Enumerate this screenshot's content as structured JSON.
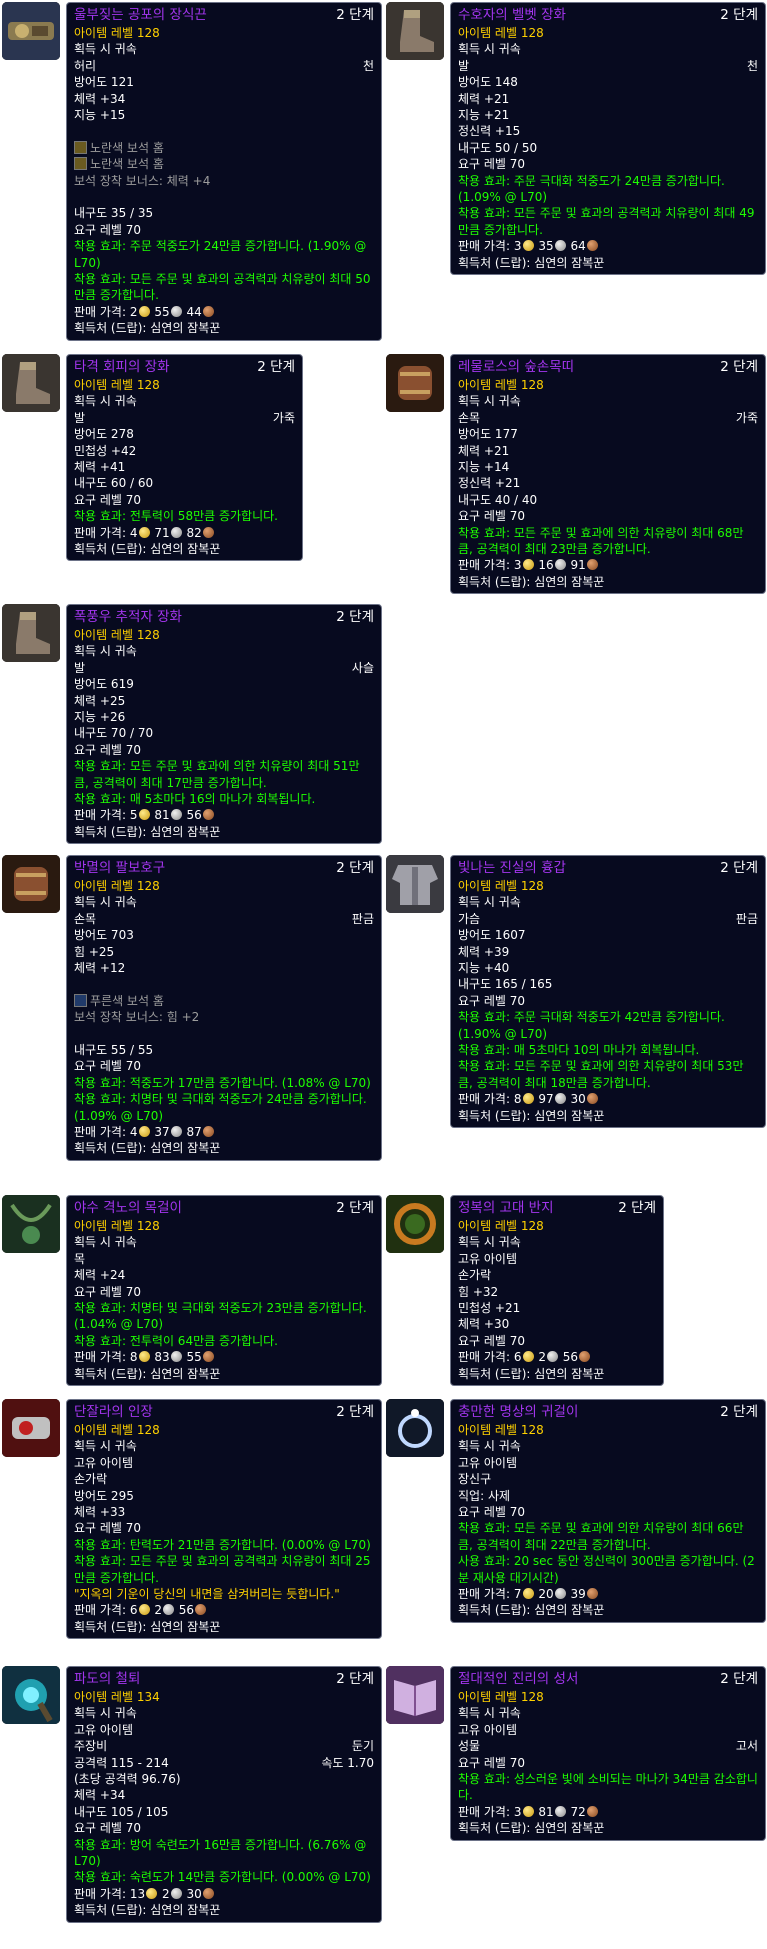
{
  "ui": {
    "stage_suffix": "단계"
  },
  "items": [
    {
      "id": "item1",
      "icon": "belt-icon",
      "name": "울부짖는 공포의 장식끈",
      "stage": "2",
      "rows": [
        {
          "t": "lvl",
          "text": "아이템 레벨 128"
        },
        {
          "t": "txt",
          "text": "획득 시 귀속"
        },
        {
          "t": "slot",
          "text": "허리",
          "right": "천"
        },
        {
          "t": "txt",
          "text": "방어도 121"
        },
        {
          "t": "txt",
          "text": "체력 +34"
        },
        {
          "t": "txt",
          "text": "지능 +15"
        },
        {
          "t": "blank"
        },
        {
          "t": "gem",
          "gem": "y",
          "text": "노란색 보석 홈"
        },
        {
          "t": "gem",
          "gem": "y",
          "text": "노란색 보석 홈"
        },
        {
          "t": "gray",
          "text": "보석 장착 보너스: 체력 +4"
        },
        {
          "t": "blank"
        },
        {
          "t": "txt",
          "text": "내구도 35 / 35"
        },
        {
          "t": "txt",
          "text": "요구 레벨 70"
        },
        {
          "t": "green",
          "text": "착용 효과: 주문 적중도가 24만큼 증가합니다. (1.90% @ L70)"
        },
        {
          "t": "green",
          "text": "착용 효과: 모든 주문 및 효과의 공격력과 치유량이 최대 50만큼 증가합니다."
        },
        {
          "t": "price",
          "label": "판매 가격:",
          "gold": "2",
          "silver": "55",
          "copper": "44"
        },
        {
          "t": "txt",
          "text": "획득처 (드랍): 심연의 잠복꾼"
        }
      ]
    },
    {
      "id": "item2",
      "icon": "boot-icon",
      "name": "수호자의 벨벳 장화",
      "stage": "2",
      "rows": [
        {
          "t": "lvl",
          "text": "아이템 레벨 128"
        },
        {
          "t": "txt",
          "text": "획득 시 귀속"
        },
        {
          "t": "slot",
          "text": "발",
          "right": "천"
        },
        {
          "t": "txt",
          "text": "방어도 148"
        },
        {
          "t": "txt",
          "text": "체력 +21"
        },
        {
          "t": "txt",
          "text": "지능 +21"
        },
        {
          "t": "txt",
          "text": "정신력 +15"
        },
        {
          "t": "txt",
          "text": "내구도 50 / 50"
        },
        {
          "t": "txt",
          "text": "요구 레벨 70"
        },
        {
          "t": "green",
          "text": "착용 효과: 주문 극대화 적중도가 24만큼 증가합니다. (1.09% @ L70)"
        },
        {
          "t": "green",
          "text": "착용 효과: 모든 주문 및 효과의 공격력과 치유량이 최대 49만큼 증가합니다."
        },
        {
          "t": "price",
          "label": "판매 가격:",
          "gold": "3",
          "silver": "35",
          "copper": "64"
        },
        {
          "t": "txt",
          "text": "획득처 (드랍): 심연의 잠복꾼"
        }
      ]
    },
    {
      "id": "item3",
      "icon": "boot-icon",
      "name": "타격 회피의 장화",
      "stage": "2",
      "rows": [
        {
          "t": "lvl",
          "text": "아이템 레벨 128"
        },
        {
          "t": "txt",
          "text": "획득 시 귀속"
        },
        {
          "t": "slot",
          "text": "발",
          "right": "가죽"
        },
        {
          "t": "txt",
          "text": "방어도 278"
        },
        {
          "t": "txt",
          "text": "민첩성 +42"
        },
        {
          "t": "txt",
          "text": "체력 +41"
        },
        {
          "t": "txt",
          "text": "내구도 60 / 60"
        },
        {
          "t": "txt",
          "text": "요구 레벨 70"
        },
        {
          "t": "green",
          "text": "착용 효과: 전투력이 58만큼 증가합니다."
        },
        {
          "t": "price",
          "label": "판매 가격:",
          "gold": "4",
          "silver": "71",
          "copper": "82"
        },
        {
          "t": "txt",
          "text": "획득처 (드랍): 심연의 잠복꾼"
        }
      ]
    },
    {
      "id": "item4",
      "icon": "bracer-icon",
      "name": "레물로스의 숲손목띠",
      "stage": "2",
      "rows": [
        {
          "t": "lvl",
          "text": "아이템 레벨 128"
        },
        {
          "t": "txt",
          "text": "획득 시 귀속"
        },
        {
          "t": "slot",
          "text": "손목",
          "right": "가죽"
        },
        {
          "t": "txt",
          "text": "방어도 177"
        },
        {
          "t": "txt",
          "text": "체력 +21"
        },
        {
          "t": "txt",
          "text": "지능 +14"
        },
        {
          "t": "txt",
          "text": "정신력 +21"
        },
        {
          "t": "txt",
          "text": "내구도 40 / 40"
        },
        {
          "t": "txt",
          "text": "요구 레벨 70"
        },
        {
          "t": "green",
          "text": "착용 효과: 모든 주문 및 효과에 의한 치유량이 최대 68만큼, 공격력이 최대 23만큼 증가합니다."
        },
        {
          "t": "price",
          "label": "판매 가격:",
          "gold": "3",
          "silver": "16",
          "copper": "91"
        },
        {
          "t": "txt",
          "text": "획득처 (드랍): 심연의 잠복꾼"
        }
      ]
    },
    {
      "id": "item5",
      "icon": "boot-icon",
      "name": "폭풍우 추적자 장화",
      "stage": "2",
      "rows": [
        {
          "t": "lvl",
          "text": "아이템 레벨 128"
        },
        {
          "t": "txt",
          "text": "획득 시 귀속"
        },
        {
          "t": "slot",
          "text": "발",
          "right": "사슬"
        },
        {
          "t": "txt",
          "text": "방어도 619"
        },
        {
          "t": "txt",
          "text": "체력 +25"
        },
        {
          "t": "txt",
          "text": "지능 +26"
        },
        {
          "t": "txt",
          "text": "내구도 70 / 70"
        },
        {
          "t": "txt",
          "text": "요구 레벨 70"
        },
        {
          "t": "green",
          "text": "착용 효과: 모든 주문 및 효과에 의한 치유량이 최대 51만큼, 공격력이 최대 17만큼 증가합니다."
        },
        {
          "t": "green",
          "text": "착용 효과: 매 5초마다 16의 마나가 회복됩니다."
        },
        {
          "t": "price",
          "label": "판매 가격:",
          "gold": "5",
          "silver": "81",
          "copper": "56"
        },
        {
          "t": "txt",
          "text": "획득처 (드랍): 심연의 잠복꾼"
        }
      ]
    },
    {
      "id": "item6",
      "icon": "bracer-icon",
      "name": "박멸의 팔보호구",
      "stage": "2",
      "rows": [
        {
          "t": "lvl",
          "text": "아이템 레벨 128"
        },
        {
          "t": "txt",
          "text": "획득 시 귀속"
        },
        {
          "t": "slot",
          "text": "손목",
          "right": "판금"
        },
        {
          "t": "txt",
          "text": "방어도 703"
        },
        {
          "t": "txt",
          "text": "힘 +25"
        },
        {
          "t": "txt",
          "text": "체력 +12"
        },
        {
          "t": "blank"
        },
        {
          "t": "gem",
          "gem": "b",
          "text": "푸른색 보석 홈"
        },
        {
          "t": "gray",
          "text": "보석 장착 보너스: 힘 +2"
        },
        {
          "t": "blank"
        },
        {
          "t": "txt",
          "text": "내구도 55 / 55"
        },
        {
          "t": "txt",
          "text": "요구 레벨 70"
        },
        {
          "t": "green",
          "text": "착용 효과: 적중도가 17만큼 증가합니다. (1.08% @ L70)"
        },
        {
          "t": "green",
          "text": "착용 효과: 치명타 및 극대화 적중도가 24만큼 증가합니다. (1.09% @ L70)"
        },
        {
          "t": "price",
          "label": "판매 가격:",
          "gold": "4",
          "silver": "37",
          "copper": "87"
        },
        {
          "t": "txt",
          "text": "획득처 (드랍): 심연의 잠복꾼"
        }
      ]
    },
    {
      "id": "item7",
      "icon": "chest-icon",
      "name": "빛나는 진실의 흉갑",
      "stage": "2",
      "rows": [
        {
          "t": "lvl",
          "text": "아이템 레벨 128"
        },
        {
          "t": "txt",
          "text": "획득 시 귀속"
        },
        {
          "t": "slot",
          "text": "가슴",
          "right": "판금"
        },
        {
          "t": "txt",
          "text": "방어도 1607"
        },
        {
          "t": "txt",
          "text": "체력 +39"
        },
        {
          "t": "txt",
          "text": "지능 +40"
        },
        {
          "t": "txt",
          "text": "내구도 165 / 165"
        },
        {
          "t": "txt",
          "text": "요구 레벨 70"
        },
        {
          "t": "green",
          "text": "착용 효과: 주문 극대화 적중도가 42만큼 증가합니다. (1.90% @ L70)"
        },
        {
          "t": "green",
          "text": "착용 효과: 매 5초마다 10의 마나가 회복됩니다."
        },
        {
          "t": "green",
          "text": "착용 효과: 모든 주문 및 효과에 의한 치유량이 최대 53만큼, 공격력이 최대 18만큼 증가합니다."
        },
        {
          "t": "price",
          "label": "판매 가격:",
          "gold": "8",
          "silver": "97",
          "copper": "30"
        },
        {
          "t": "txt",
          "text": "획득처 (드랍): 심연의 잠복꾼"
        }
      ]
    },
    {
      "id": "item8",
      "icon": "necklace-icon",
      "name": "야수 격노의 목걸이",
      "stage": "2",
      "rows": [
        {
          "t": "lvl",
          "text": "아이템 레벨 128"
        },
        {
          "t": "txt",
          "text": "획득 시 귀속"
        },
        {
          "t": "txt",
          "text": "목"
        },
        {
          "t": "txt",
          "text": "체력 +24"
        },
        {
          "t": "txt",
          "text": "요구 레벨 70"
        },
        {
          "t": "green",
          "text": "착용 효과: 치명타 및 극대화 적중도가 23만큼 증가합니다. (1.04% @ L70)"
        },
        {
          "t": "green",
          "text": "착용 효과: 전투력이 64만큼 증가합니다."
        },
        {
          "t": "price",
          "label": "판매 가격:",
          "gold": "8",
          "silver": "83",
          "copper": "55"
        },
        {
          "t": "txt",
          "text": "획득처 (드랍): 심연의 잠복꾼"
        }
      ]
    },
    {
      "id": "item9",
      "icon": "ring-icon",
      "name": "정복의 고대 반지",
      "stage": "2",
      "rows": [
        {
          "t": "lvl",
          "text": "아이템 레벨 128"
        },
        {
          "t": "txt",
          "text": "획득 시 귀속"
        },
        {
          "t": "txt",
          "text": "고유 아이템"
        },
        {
          "t": "txt",
          "text": "손가락"
        },
        {
          "t": "txt",
          "text": "힘 +32"
        },
        {
          "t": "txt",
          "text": "민첩성 +21"
        },
        {
          "t": "txt",
          "text": "체력 +30"
        },
        {
          "t": "txt",
          "text": "요구 레벨 70"
        },
        {
          "t": "price",
          "label": "판매 가격:",
          "gold": "6",
          "silver": "2",
          "copper": "56"
        },
        {
          "t": "txt",
          "text": "획득처 (드랍): 심연의 잠복꾼"
        }
      ]
    },
    {
      "id": "item10",
      "icon": "seal-icon",
      "name": "단잘라의 인장",
      "stage": "2",
      "rows": [
        {
          "t": "lvl",
          "text": "아이템 레벨 128"
        },
        {
          "t": "txt",
          "text": "획득 시 귀속"
        },
        {
          "t": "txt",
          "text": "고유 아이템"
        },
        {
          "t": "txt",
          "text": "손가락"
        },
        {
          "t": "txt",
          "text": "방어도 295"
        },
        {
          "t": "txt",
          "text": "체력 +33"
        },
        {
          "t": "txt",
          "text": "요구 레벨 70"
        },
        {
          "t": "green",
          "text": "착용 효과: 탄력도가 21만큼 증가합니다. (0.00% @ L70)"
        },
        {
          "t": "green",
          "text": "착용 효과: 모든 주문 및 효과의 공격력과 치유량이 최대 25만큼 증가합니다."
        },
        {
          "t": "yellow",
          "text": "\"지옥의 기운이 당신의 내면을 삼켜버리는 듯합니다.\""
        },
        {
          "t": "price",
          "label": "판매 가격:",
          "gold": "6",
          "silver": "2",
          "copper": "56"
        },
        {
          "t": "txt",
          "text": "획득처 (드랍): 심연의 잠복꾼"
        }
      ]
    },
    {
      "id": "item11",
      "icon": "earring-icon",
      "name": "충만한 명상의 귀걸이",
      "stage": "2",
      "rows": [
        {
          "t": "lvl",
          "text": "아이템 레벨 128"
        },
        {
          "t": "txt",
          "text": "획득 시 귀속"
        },
        {
          "t": "txt",
          "text": "고유 아이템"
        },
        {
          "t": "txt",
          "text": "장신구"
        },
        {
          "t": "txt",
          "text": "직업: 사제"
        },
        {
          "t": "txt",
          "text": "요구 레벨 70"
        },
        {
          "t": "green",
          "text": "착용 효과: 모든 주문 및 효과에 의한 치유량이 최대 66만큼, 공격력이 최대 22만큼 증가합니다."
        },
        {
          "t": "green",
          "text": "사용 효과: 20 sec 동안 정신력이 300만큼 증가합니다. (2 분 재사용 대기시간)"
        },
        {
          "t": "price",
          "label": "판매 가격:",
          "gold": "7",
          "silver": "20",
          "copper": "39"
        },
        {
          "t": "txt",
          "text": "획득처 (드랍): 심연의 잠복꾼"
        }
      ]
    },
    {
      "id": "item12",
      "icon": "staff-icon",
      "name": "파도의 철퇴",
      "stage": "2",
      "rows": [
        {
          "t": "lvl",
          "text": "아이템 레벨 134"
        },
        {
          "t": "txt",
          "text": "획득 시 귀속"
        },
        {
          "t": "txt",
          "text": "고유 아이템"
        },
        {
          "t": "slot",
          "text": "주장비",
          "right": "둔기"
        },
        {
          "t": "slot",
          "text": "공격력 115 - 214",
          "right": "속도 1.70"
        },
        {
          "t": "txt",
          "text": "(초당 공격력 96.76)"
        },
        {
          "t": "txt",
          "text": "체력 +34"
        },
        {
          "t": "txt",
          "text": "내구도 105 / 105"
        },
        {
          "t": "txt",
          "text": "요구 레벨 70"
        },
        {
          "t": "green",
          "text": "착용 효과: 방어 숙련도가 16만큼 증가합니다. (6.76% @ L70)"
        },
        {
          "t": "green",
          "text": "착용 효과: 숙련도가 14만큼 증가합니다. (0.00% @ L70)"
        },
        {
          "t": "price",
          "label": "판매 가격:",
          "gold": "13",
          "silver": "2",
          "copper": "30"
        },
        {
          "t": "txt",
          "text": "획득처 (드랍): 심연의 잠복꾼"
        }
      ]
    },
    {
      "id": "item13",
      "icon": "book-icon",
      "name": "절대적인 진리의 성서",
      "stage": "2",
      "rows": [
        {
          "t": "lvl",
          "text": "아이템 레벨 128"
        },
        {
          "t": "txt",
          "text": "획득 시 귀속"
        },
        {
          "t": "txt",
          "text": "고유 아이템"
        },
        {
          "t": "slot",
          "text": "성물",
          "right": "고서"
        },
        {
          "t": "txt",
          "text": "요구 레벨 70"
        },
        {
          "t": "green",
          "text": "착용 효과: 성스러운 빛에 소비되는 마나가 34만큼 감소합니다."
        },
        {
          "t": "price",
          "label": "판매 가격:",
          "gold": "3",
          "silver": "81",
          "copper": "72"
        },
        {
          "t": "txt",
          "text": "획득처 (드랍): 심연의 잠복꾼"
        }
      ]
    }
  ]
}
